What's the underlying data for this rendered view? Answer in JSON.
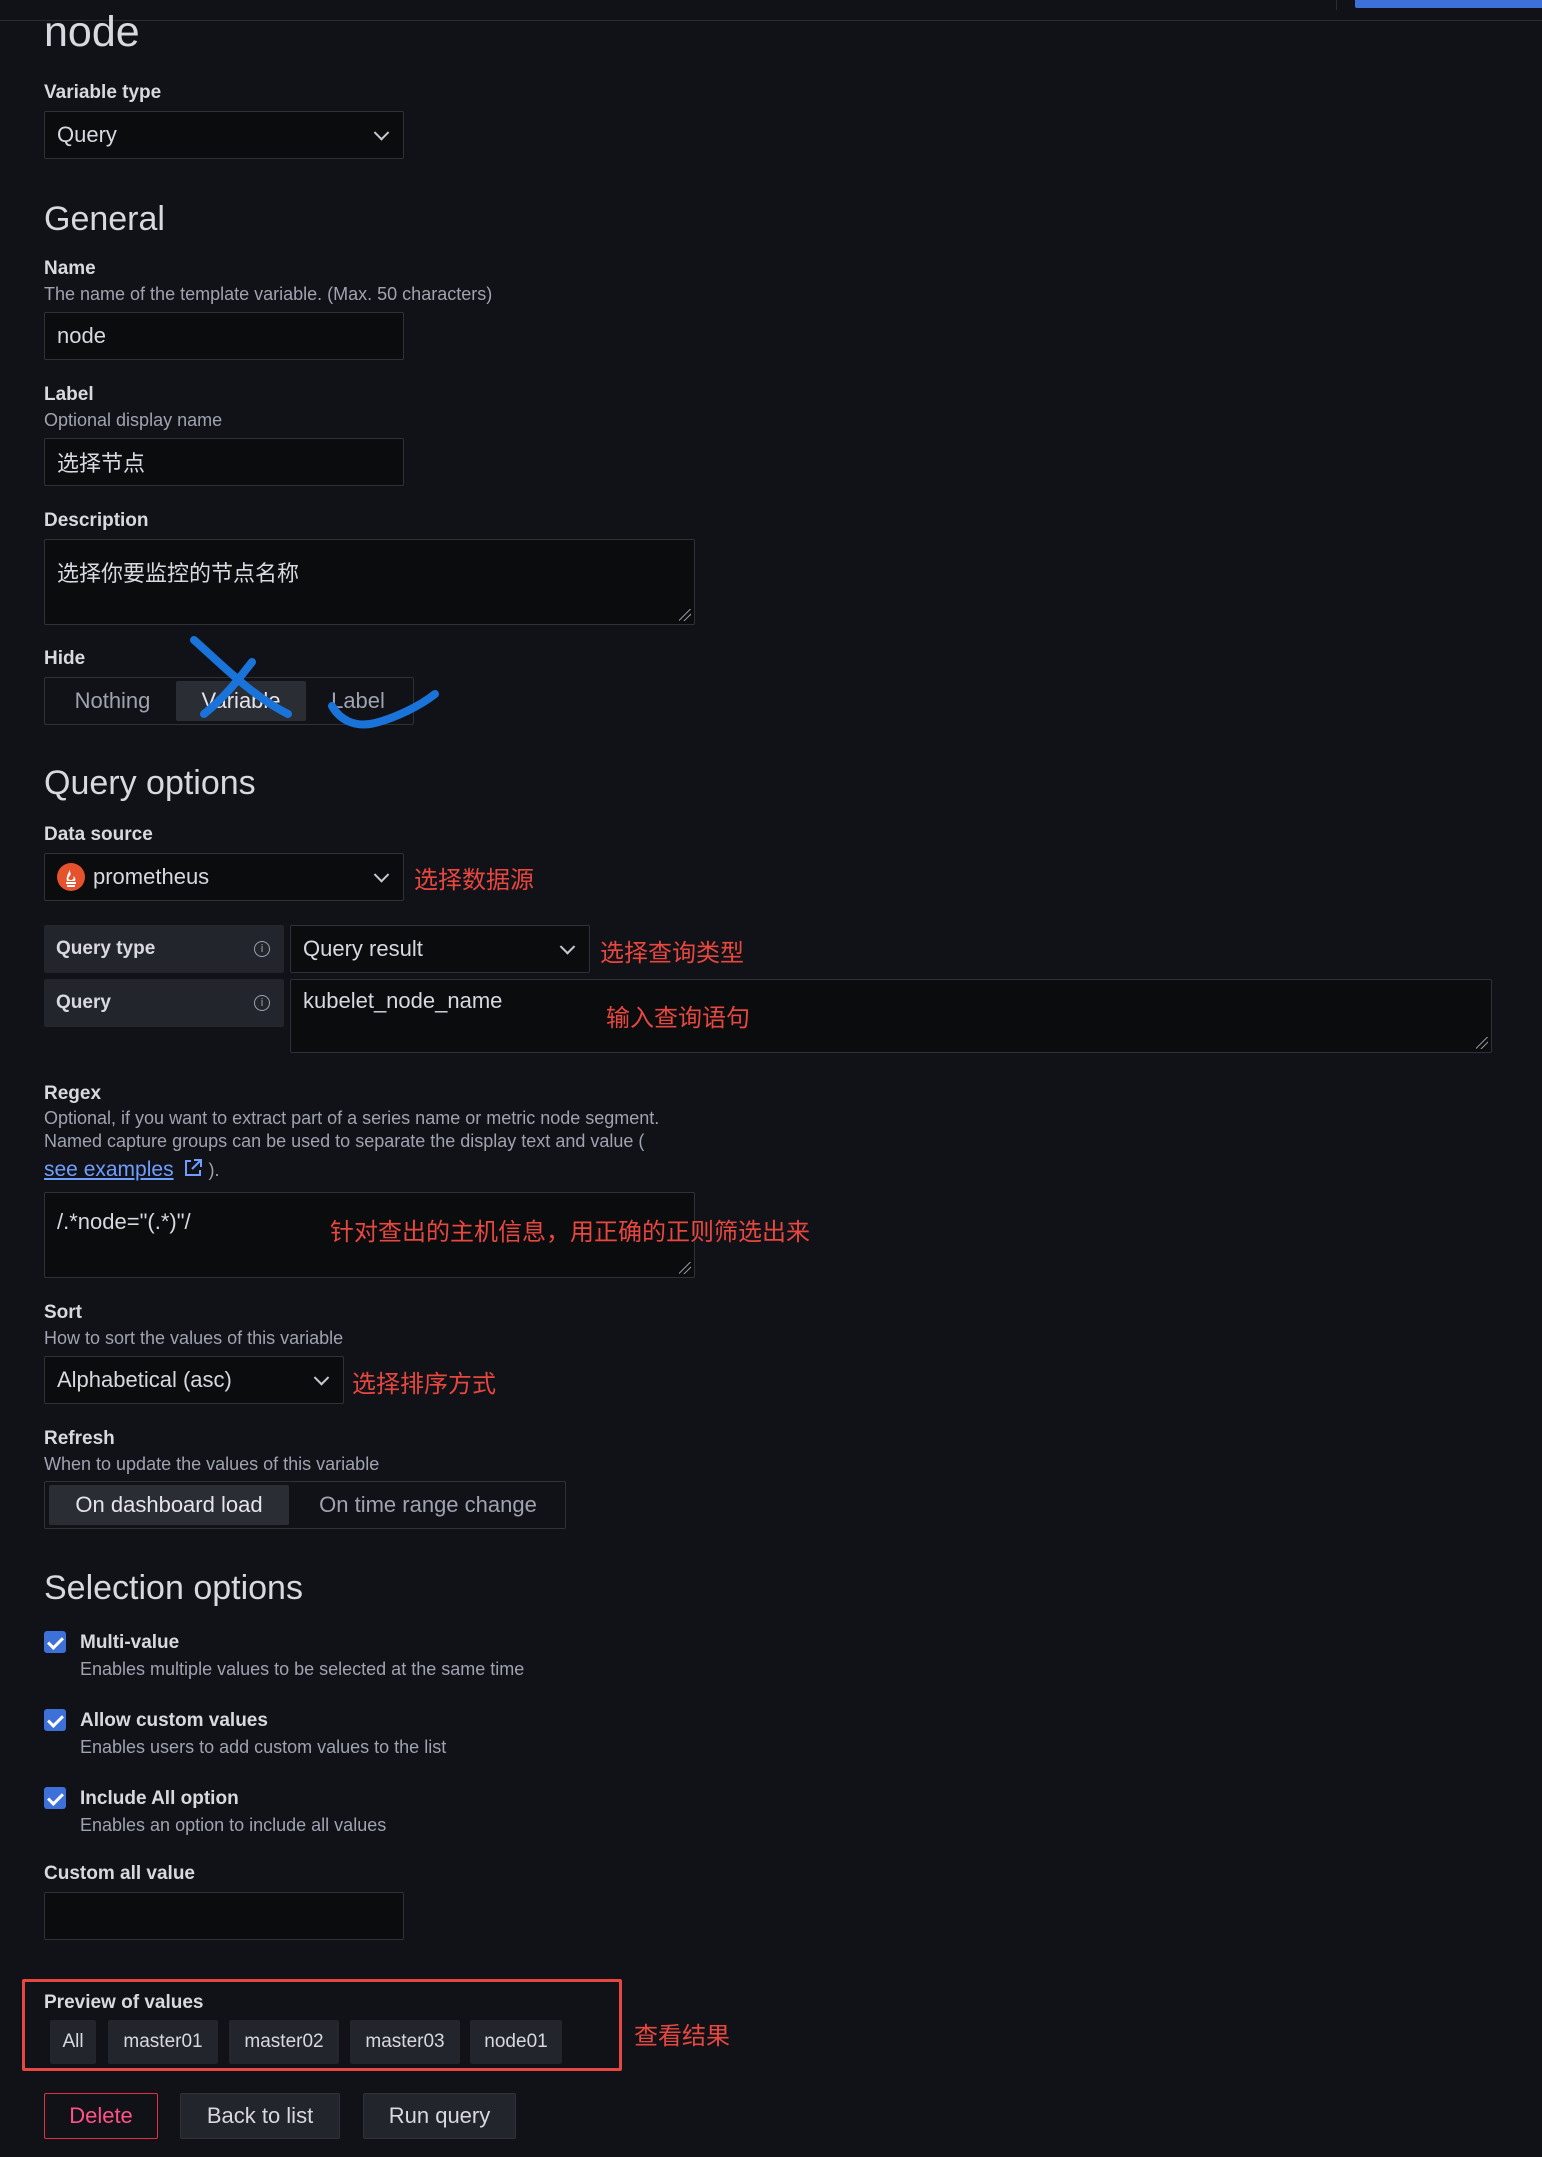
{
  "page_title": "node",
  "variable_type": {
    "label": "Variable type",
    "value": "Query"
  },
  "general": {
    "heading": "General",
    "name": {
      "label": "Name",
      "description": "The name of the template variable. (Max. 50 characters)",
      "value": "node"
    },
    "display_label": {
      "label": "Label",
      "description": "Optional display name",
      "value": "选择节点"
    },
    "description": {
      "label": "Description",
      "value": "选择你要监控的节点名称"
    },
    "hide": {
      "label": "Hide",
      "options": [
        "Nothing",
        "Variable",
        "Label"
      ],
      "selected": "Variable"
    }
  },
  "query_options": {
    "heading": "Query options",
    "data_source": {
      "label": "Data source",
      "value": "prometheus",
      "icon": "prometheus-icon"
    },
    "query_type": {
      "label": "Query type",
      "value": "Query result"
    },
    "query": {
      "label": "Query",
      "value": "kubelet_node_name"
    },
    "regex": {
      "label": "Regex",
      "description_line1": "Optional, if you want to extract part of a series name or metric node segment.",
      "description_line2": "Named capture groups can be used to separate the display text and value (",
      "link_text": "see examples",
      "suffix": ").",
      "value": "/.*node=\"(.*)\"/"
    },
    "sort": {
      "label": "Sort",
      "description": "How to sort the values of this variable",
      "value": "Alphabetical (asc)"
    },
    "refresh": {
      "label": "Refresh",
      "description": "When to update the values of this variable",
      "options": [
        "On dashboard load",
        "On time range change"
      ],
      "selected": "On dashboard load"
    }
  },
  "selection_options": {
    "heading": "Selection options",
    "multi_value": {
      "label": "Multi-value",
      "description": "Enables multiple values to be selected at the same time",
      "checked": true
    },
    "allow_custom": {
      "label": "Allow custom values",
      "description": "Enables users to add custom values to the list",
      "checked": true
    },
    "include_all": {
      "label": "Include All option",
      "description": "Enables an option to include all values",
      "checked": true
    },
    "custom_all_value": {
      "label": "Custom all value",
      "value": ""
    }
  },
  "preview": {
    "label": "Preview of values",
    "values": [
      "All",
      "master01",
      "master02",
      "master03",
      "node01"
    ]
  },
  "buttons": {
    "delete": "Delete",
    "back": "Back to list",
    "run": "Run query"
  },
  "annotations": {
    "data_source": "选择数据源",
    "query_type": "选择查询类型",
    "query": "输入查询语句",
    "regex": "针对查出的主机信息，用正确的正则筛选出来",
    "sort": "选择排序方式",
    "preview": "查看结果"
  },
  "colors": {
    "accent": "#3d71d9",
    "annotation": "#e8473f",
    "pen": "#1a73d9",
    "danger": "#e02f44"
  }
}
